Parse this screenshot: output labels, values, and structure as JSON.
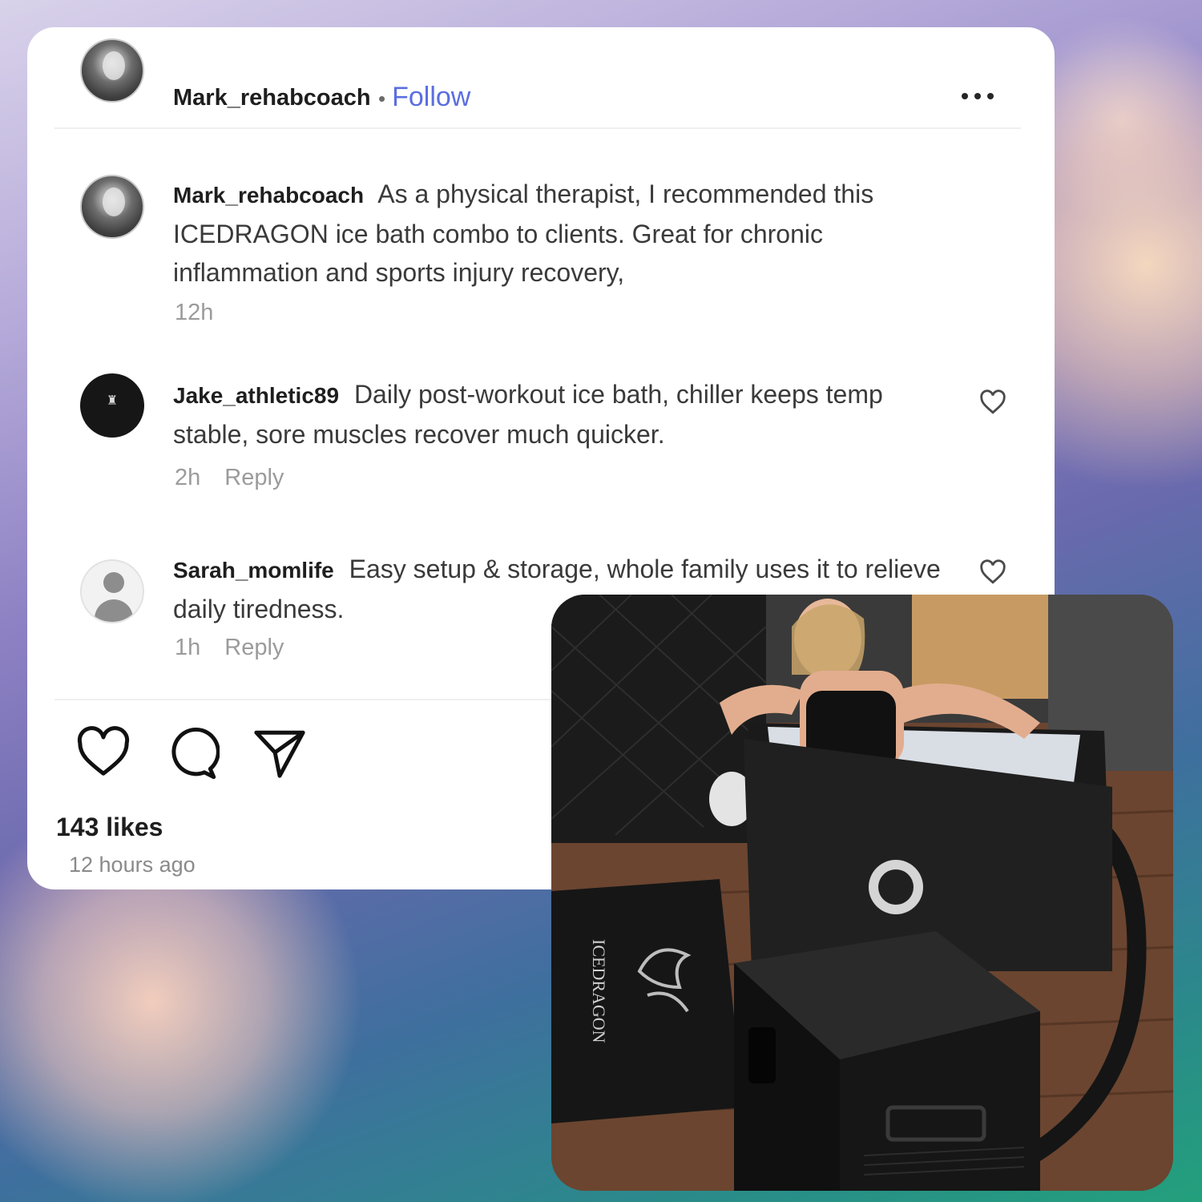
{
  "post": {
    "author": "Mark_rehabcoach",
    "separator": "•",
    "follow_label": "Follow",
    "more_label": "More options"
  },
  "comments": [
    {
      "username": "Mark_rehabcoach",
      "text": "As a physical therapist, I recommended this ICEDRAGON ice bath combo to clients.  Great for chronic inflammation and sports injury recovery,",
      "time": "12h",
      "reply": ""
    },
    {
      "username": "Jake_athletic89",
      "text": "Daily post-workout ice bath, chiller keeps temp stable, sore muscles recover much quicker.",
      "time": "2h",
      "reply": "Reply"
    },
    {
      "username": "Sarah_momlife",
      "text": "Easy setup & storage, whole family uses it to relieve daily tiredness.",
      "time": "1h",
      "reply": "Reply"
    }
  ],
  "footer": {
    "likes": "143 likes",
    "posted": "12 hours ago"
  },
  "photo": {
    "brand_mat": "ICEDRAGON",
    "alt": "Woman sitting in a black ICEDRAGON ice bath tub next to a black chiller unit"
  },
  "icons": [
    "more-icon",
    "heart-icon",
    "comment-icon",
    "share-icon",
    "avatar-icon"
  ],
  "colors": {
    "link": "#5b6ee0",
    "text": "#1e1e1e",
    "muted": "#9b9b9b"
  }
}
